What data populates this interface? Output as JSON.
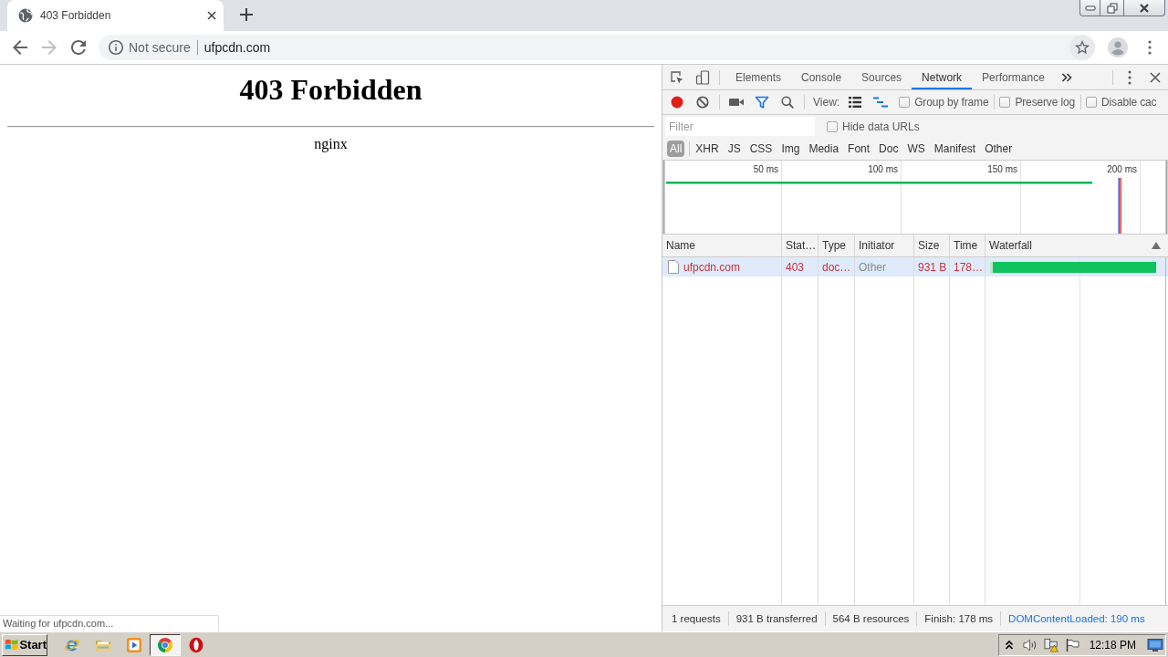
{
  "browser": {
    "tab": {
      "title": "403 Forbidden"
    },
    "nav_buttons": [
      {
        "kind": "back",
        "disabled": false
      },
      {
        "kind": "forward",
        "disabled": true
      },
      {
        "kind": "reload",
        "disabled": false
      }
    ],
    "address_bar": {
      "security_label": "Not secure",
      "url": "ufpcdn.com"
    }
  },
  "page": {
    "heading": "403 Forbidden",
    "server": "nginx",
    "status_bubble": "Waiting for ufpcdn.com..."
  },
  "devtools": {
    "panel_tabs": [
      {
        "label": "Elements",
        "selected": false
      },
      {
        "label": "Console",
        "selected": false
      },
      {
        "label": "Sources",
        "selected": false
      },
      {
        "label": "Network",
        "selected": true
      },
      {
        "label": "Performance",
        "selected": false
      }
    ],
    "toolbar": {
      "recording": true,
      "filter_open": true,
      "view_label": "View:",
      "overview_on": true,
      "options": [
        {
          "label": "Group by frame",
          "checked": false
        },
        {
          "label": "Preserve log",
          "checked": false
        },
        {
          "label": "Disable cac",
          "checked": false
        }
      ]
    },
    "filter": {
      "placeholder": "Filter",
      "hide_data_urls": {
        "label": "Hide data URLs",
        "checked": false
      }
    },
    "type_filters": [
      {
        "label": "All",
        "selected": true
      },
      {
        "label": "XHR",
        "selected": false
      },
      {
        "label": "JS",
        "selected": false
      },
      {
        "label": "CSS",
        "selected": false
      },
      {
        "label": "Img",
        "selected": false
      },
      {
        "label": "Media",
        "selected": false
      },
      {
        "label": "Font",
        "selected": false
      },
      {
        "label": "Doc",
        "selected": false
      },
      {
        "label": "WS",
        "selected": false
      },
      {
        "label": "Manifest",
        "selected": false
      },
      {
        "label": "Other",
        "selected": false
      }
    ],
    "overview": {
      "ticks": [
        "50 ms",
        "100 ms",
        "150 ms",
        "200 ms"
      ]
    },
    "columns": [
      {
        "label": "Name",
        "sorted": false
      },
      {
        "label": "Stat…",
        "sorted": false
      },
      {
        "label": "Type",
        "sorted": false
      },
      {
        "label": "Initiator",
        "sorted": false
      },
      {
        "label": "Size",
        "sorted": false
      },
      {
        "label": "Time",
        "sorted": false
      },
      {
        "label": "Waterfall",
        "sorted": true
      }
    ],
    "requests": [
      {
        "name": "ufpcdn.com",
        "status": "403",
        "type": "doc…",
        "initiator": "Other",
        "size": "931 B",
        "time": "178…",
        "error": true,
        "hovered": true
      }
    ],
    "summary": [
      {
        "text": "1 requests",
        "kind": "plain"
      },
      {
        "text": "931 B transferred",
        "kind": "plain"
      },
      {
        "text": "564 B resources",
        "kind": "plain"
      },
      {
        "text": "Finish: 178 ms",
        "kind": "plain"
      },
      {
        "text": "DOMContentLoaded: 190 ms",
        "kind": "dom_content_loaded"
      }
    ]
  },
  "taskbar": {
    "start_label": "Start",
    "apps": [
      {
        "kind": "e_logo",
        "active": false
      },
      {
        "kind": "folder",
        "active": false
      },
      {
        "kind": "player",
        "active": false
      },
      {
        "kind": "round_logo",
        "active": true
      },
      {
        "kind": "o_logo",
        "active": false
      }
    ],
    "clock": "12:18 PM"
  }
}
